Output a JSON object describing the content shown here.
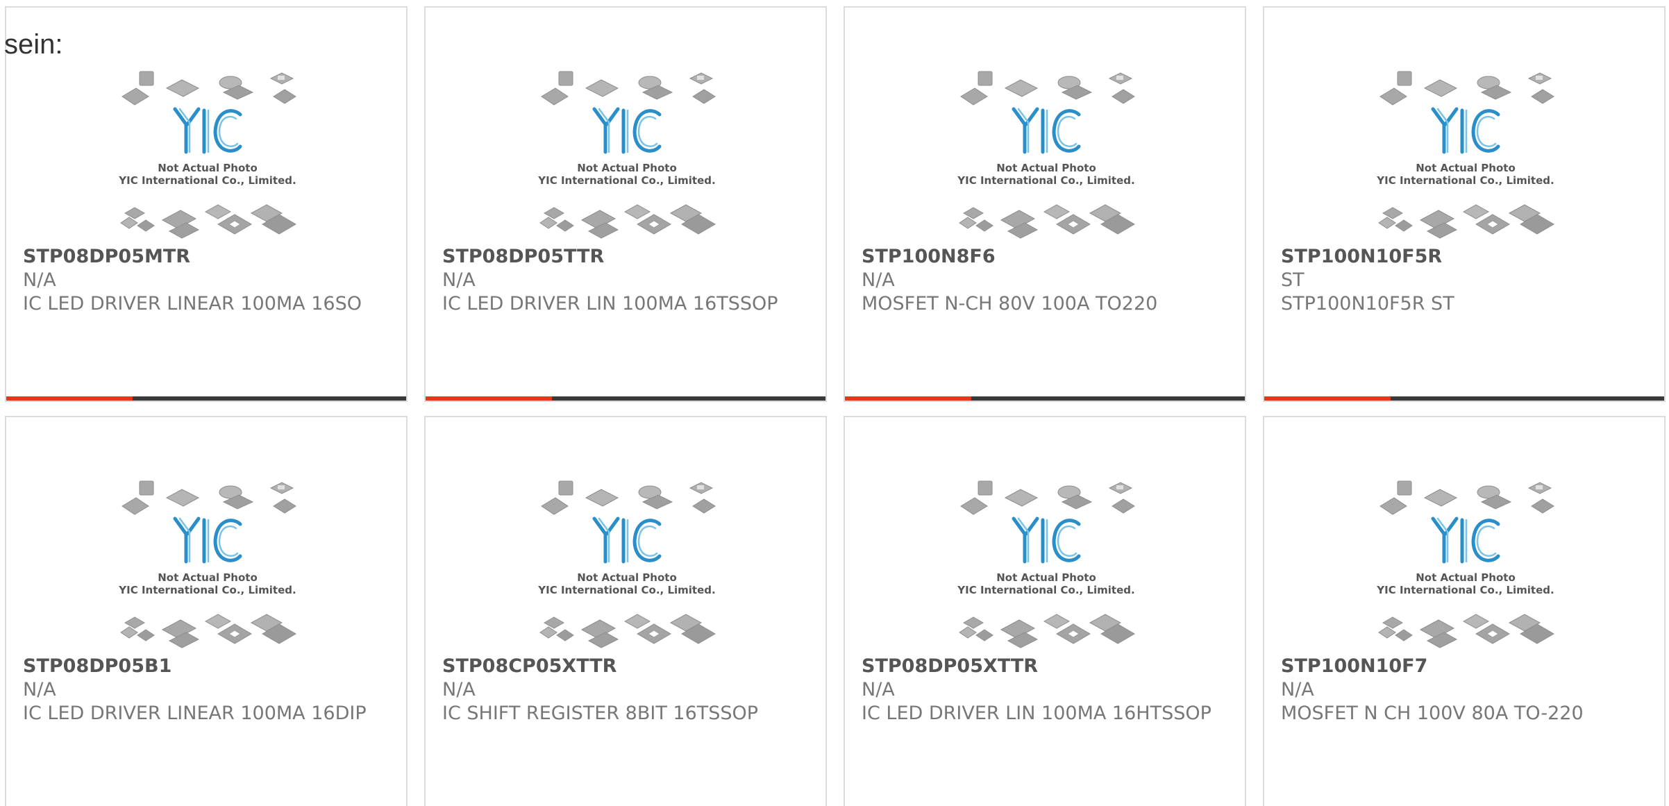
{
  "lead_text": "sein:",
  "placeholder_image": {
    "brand": "YIC",
    "line1": "Not Actual Photo",
    "line2": "YIC International Co., Limited.",
    "colors": {
      "brand_blue": "#2a8fc8",
      "chip_gray": "#a8a8a8",
      "caption": "#555555"
    }
  },
  "accent_color": "#e8361b",
  "bar_color": "#3a3a3a",
  "products": [
    {
      "part": "STP08DP05MTR",
      "mfr": "N/A",
      "desc": "IC LED DRIVER LINEAR 100MA 16SO"
    },
    {
      "part": "STP08DP05TTR",
      "mfr": "N/A",
      "desc": "IC LED DRIVER LIN 100MA 16TSSOP"
    },
    {
      "part": "STP100N8F6",
      "mfr": "N/A",
      "desc": "MOSFET N-CH 80V 100A TO220"
    },
    {
      "part": "STP100N10F5R",
      "mfr": "ST",
      "desc": "STP100N10F5R ST"
    },
    {
      "part": "STP08DP05B1",
      "mfr": "N/A",
      "desc": "IC LED DRIVER LINEAR 100MA 16DIP"
    },
    {
      "part": "STP08CP05XTTR",
      "mfr": "N/A",
      "desc": "IC SHIFT REGISTER 8BIT 16TSSOP"
    },
    {
      "part": "STP08DP05XTTR",
      "mfr": "N/A",
      "desc": "IC LED DRIVER LIN 100MA 16HTSSOP"
    },
    {
      "part": "STP100N10F7",
      "mfr": "N/A",
      "desc": "MOSFET N CH 100V 80A TO-220"
    }
  ]
}
